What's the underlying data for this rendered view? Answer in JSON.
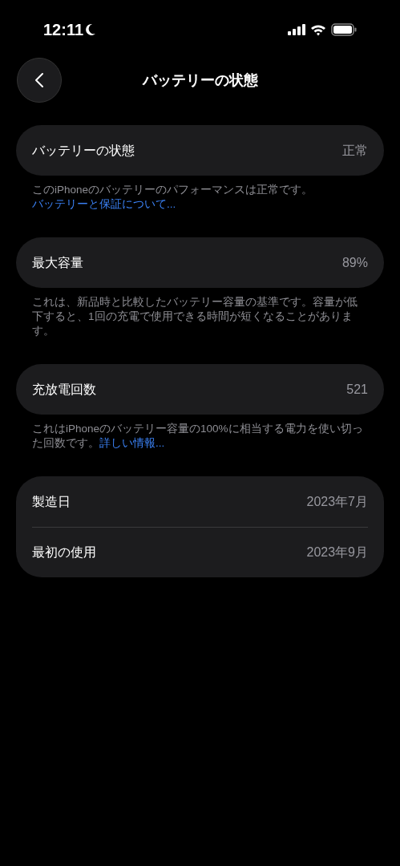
{
  "status_bar": {
    "time": "12:11"
  },
  "nav": {
    "title": "バッテリーの状態"
  },
  "sections": [
    {
      "rows": [
        {
          "label": "バッテリーの状態",
          "value": "正常"
        }
      ],
      "footer": {
        "text": "このiPhoneのバッテリーのパフォーマンスは正常です。",
        "link": "バッテリーと保証について..."
      }
    },
    {
      "rows": [
        {
          "label": "最大容量",
          "value": "89%"
        }
      ],
      "footer": {
        "text": "これは、新品時と比較したバッテリー容量の基準です。容量が低下すると、1回の充電で使用できる時間が短くなることがあります。"
      }
    },
    {
      "rows": [
        {
          "label": "充放電回数",
          "value": "521"
        }
      ],
      "footer": {
        "text": "これはiPhoneのバッテリー容量の100%に相当する電力を使い切った回数です。",
        "link": "詳しい情報..."
      }
    },
    {
      "rows": [
        {
          "label": "製造日",
          "value": "2023年7月"
        },
        {
          "label": "最初の使用",
          "value": "2023年9月"
        }
      ]
    }
  ]
}
